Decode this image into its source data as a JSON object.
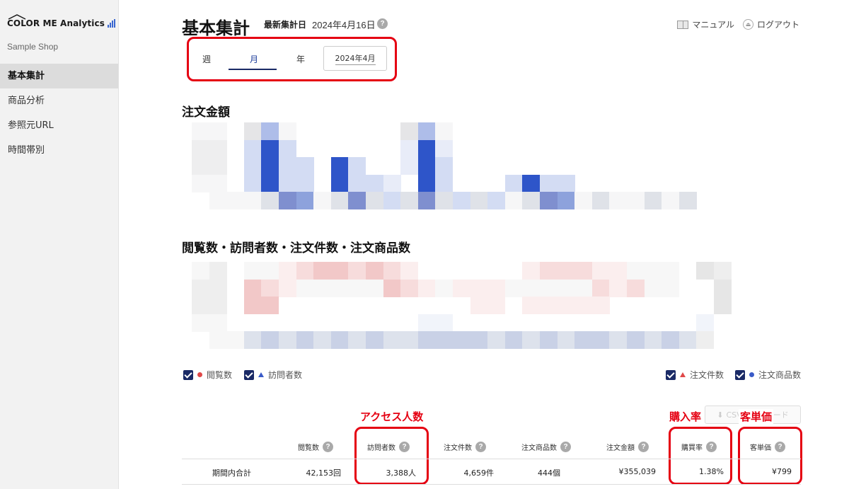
{
  "sidebar": {
    "logo": "COLOR ME Analytics",
    "shop": "Sample Shop",
    "items": [
      {
        "label": "基本集計",
        "active": true
      },
      {
        "label": "商品分析",
        "active": false
      },
      {
        "label": "参照元URL",
        "active": false
      },
      {
        "label": "時間帯別",
        "active": false
      }
    ]
  },
  "header": {
    "title": "基本集計",
    "latest_label": "最新集計日",
    "latest_date": "2024年4月16日",
    "help_glyph": "?",
    "manual": "マニュアル",
    "logout": "ログアウト"
  },
  "period": {
    "tabs": [
      "週",
      "月",
      "年"
    ],
    "active": "月",
    "selected_month": "2024年4月"
  },
  "sections": {
    "order_amount": "注文金額",
    "metrics": "閲覧数・訪問者数・注文件数・注文商品数"
  },
  "legend": {
    "views": "閲覧数",
    "visitors": "訪問者数",
    "orders": "注文件数",
    "order_items": "注文商品数"
  },
  "csv_button": "CSVダウンロード",
  "annotations": {
    "access": "アクセス人数",
    "purchase_rate": "購入率",
    "unit_price": "客単価"
  },
  "table": {
    "headers": [
      "閲覧数",
      "訪問者数",
      "注文件数",
      "注文商品数",
      "注文金額",
      "購買率",
      "客単価"
    ],
    "row_label": "期間内合計",
    "values": [
      "42,153回",
      "3,388人",
      "4,659件",
      "444個",
      "¥355,039",
      "1.38%",
      "¥799"
    ]
  },
  "colors": {
    "accent": "#e50012",
    "navy": "#1a2a66",
    "blue": "#3a5bc8",
    "red_series": "#e04848"
  }
}
